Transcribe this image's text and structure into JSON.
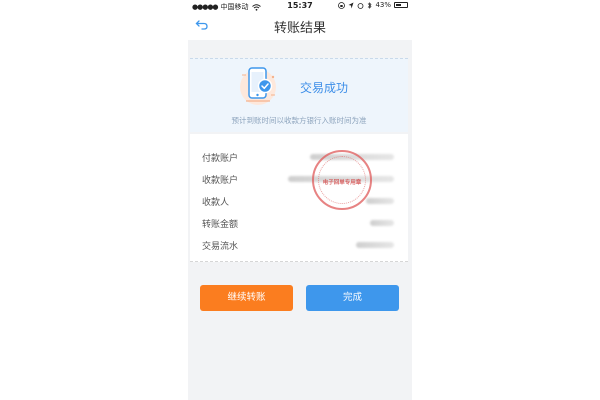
{
  "status_bar": {
    "carrier": "中国移动",
    "time": "15:37",
    "battery": "43%"
  },
  "header": {
    "title": "转账结果"
  },
  "result": {
    "status": "交易成功",
    "note": "预计到账时间以收款方银行入账时间为准"
  },
  "details": {
    "rows": [
      {
        "label": "付款账户"
      },
      {
        "label": "收款账户"
      },
      {
        "label": "收款人"
      },
      {
        "label": "转账金额"
      },
      {
        "label": "交易流水"
      }
    ]
  },
  "stamp": {
    "text": "电子回单专用章"
  },
  "buttons": {
    "continue_label": "继续转账",
    "done_label": "完成"
  },
  "colors": {
    "accent_blue": "#3e97ec",
    "accent_orange": "#fb7d1f",
    "success_text": "#3d8ee8",
    "stamp_red": "#e05a5a"
  }
}
